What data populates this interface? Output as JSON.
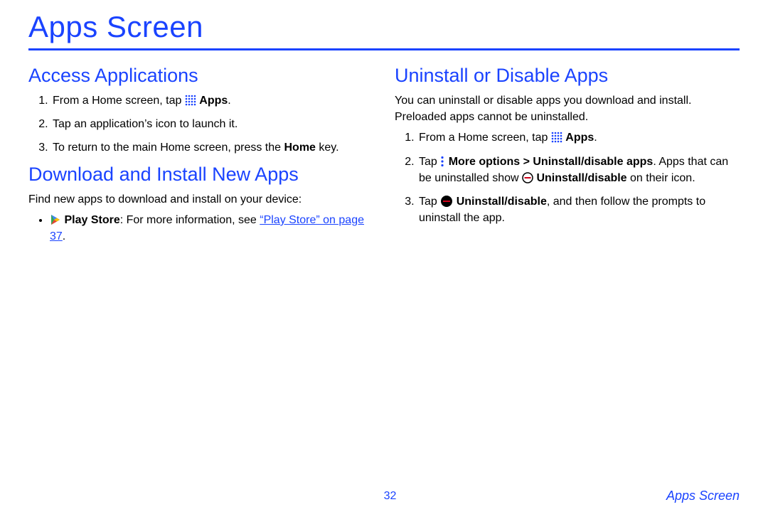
{
  "page_title": "Apps Screen",
  "footer": {
    "page_number": "32",
    "section_label": "Apps Screen"
  },
  "left": {
    "access": {
      "heading": "Access Applications",
      "step1_prefix": "From a Home screen, tap ",
      "step1_bold": "Apps",
      "step1_suffix": ".",
      "step2": "Tap an application’s icon to launch it.",
      "step3_prefix": "To return to the main Home screen, press the ",
      "step3_bold": "Home",
      "step3_suffix": " key."
    },
    "download": {
      "heading": "Download and Install New Apps",
      "intro": "Find new apps to download and install on your device:",
      "bullet_bold_label": "Play Store",
      "bullet_after_label": ": For more information, see ",
      "bullet_link_text": "“Play Store” on page 37",
      "bullet_tail": "."
    }
  },
  "right": {
    "uninstall": {
      "heading": "Uninstall or Disable Apps",
      "intro": "You can uninstall or disable apps you download and install. Preloaded apps cannot be uninstalled.",
      "step1_prefix": "From a Home screen, tap ",
      "step1_bold": "Apps",
      "step1_suffix": ".",
      "step2_prefix": "Tap ",
      "step2_bold_path": "More options > Uninstall/disable apps",
      "step2_middle": ". Apps that can be uninstalled show ",
      "step2_bold_label": "Uninstall/disable",
      "step2_suffix": " on their icon.",
      "step3_prefix": "Tap ",
      "step3_bold_label": "Uninstall/disable",
      "step3_suffix": ", and then follow the prompts to uninstall the app."
    }
  }
}
